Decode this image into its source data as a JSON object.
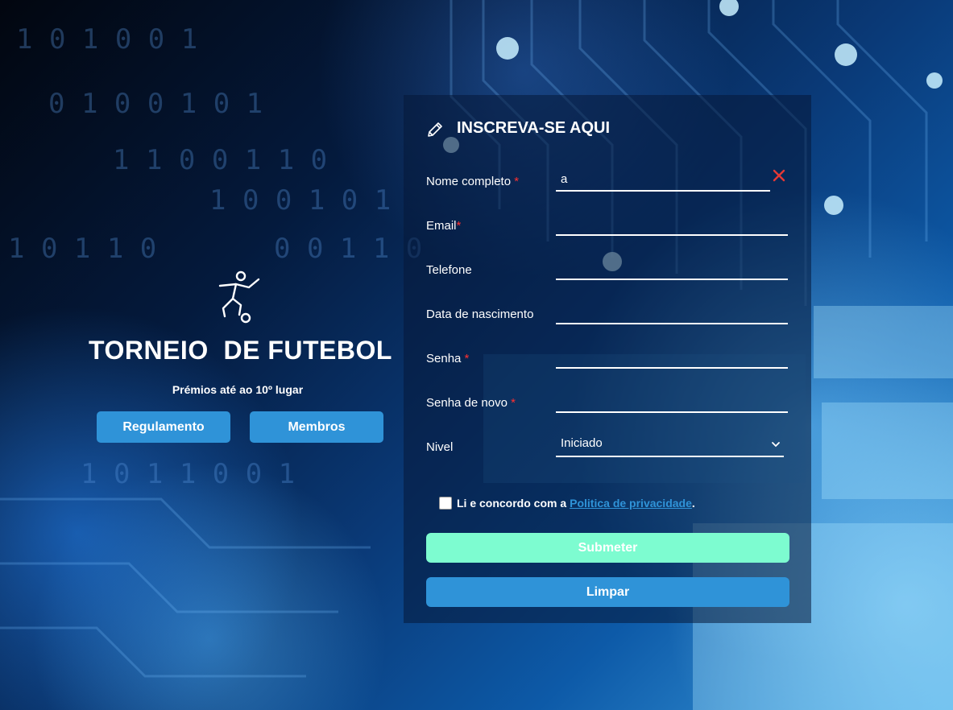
{
  "brand": {
    "icon": "soccer-player-icon",
    "title": "TORNEIO  DE FUTEBOL",
    "subtitle": "Prémios até ao 10º lugar",
    "buttons": {
      "rules": "Regulamento",
      "members": "Membros"
    }
  },
  "form": {
    "title": "INSCREVA-SE AQUI",
    "title_icon": "pencil-icon",
    "required_marker": "*",
    "fields": {
      "full_name": {
        "label": "Nome completo",
        "required": true,
        "value": "a"
      },
      "email": {
        "label": "Email",
        "required": true,
        "value": ""
      },
      "phone": {
        "label": "Telefone",
        "required": false,
        "value": ""
      },
      "birth_date": {
        "label": "Data de nascimento",
        "required": false,
        "value": ""
      },
      "password": {
        "label": "Senha",
        "required": true,
        "value": ""
      },
      "password_repeat": {
        "label": "Senha de novo",
        "required": true,
        "value": ""
      },
      "level": {
        "label": "Nivel",
        "required": false,
        "selected": "Iniciado"
      }
    },
    "consent": {
      "text": "Li e concordo com a",
      "link": "Politica de privacidade",
      "suffix": ".",
      "checked": false
    },
    "submit_label": "Submeter",
    "clear_label": "Limpar"
  },
  "colors": {
    "accent_blue": "#2f93d8",
    "submit_mint": "#7dfcd0",
    "required_red": "#ff3030",
    "error_icon": "#e53935"
  }
}
